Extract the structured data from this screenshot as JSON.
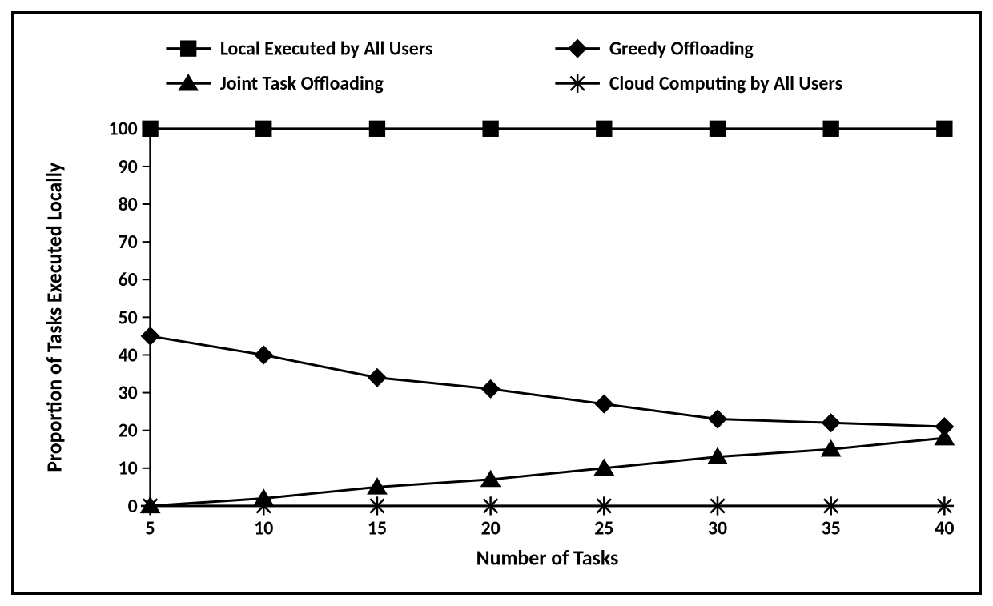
{
  "chart_data": {
    "type": "line",
    "xlabel": "Number of Tasks",
    "ylabel": "Proportion of Tasks Executed Locally",
    "x": [
      5,
      10,
      15,
      20,
      25,
      30,
      35,
      40
    ],
    "ylim": [
      0,
      100
    ],
    "yticks": [
      0,
      10,
      20,
      30,
      40,
      50,
      60,
      70,
      80,
      90,
      100
    ],
    "series": [
      {
        "name": "Local Executed by All Users",
        "marker": "square",
        "values": [
          100,
          100,
          100,
          100,
          100,
          100,
          100,
          100
        ]
      },
      {
        "name": "Greedy Offloading",
        "marker": "diamond",
        "values": [
          45,
          40,
          34,
          31,
          27,
          23,
          22,
          21
        ]
      },
      {
        "name": "Joint Task Offloading",
        "marker": "triangle",
        "values": [
          0,
          2,
          5,
          7,
          10,
          13,
          15,
          18
        ]
      },
      {
        "name": "Cloud Computing by All Users",
        "marker": "asterisk",
        "values": [
          0,
          0,
          0,
          0,
          0,
          0,
          0,
          0
        ]
      }
    ],
    "legend_layout": [
      [
        0,
        1
      ],
      [
        2,
        3
      ]
    ]
  }
}
